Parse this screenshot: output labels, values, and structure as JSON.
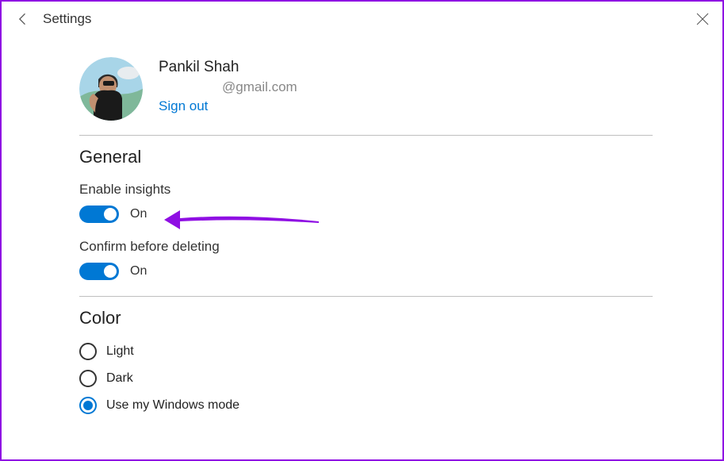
{
  "window": {
    "title": "Settings"
  },
  "profile": {
    "name": "Pankil Shah",
    "email": "@gmail.com",
    "signout": "Sign out"
  },
  "sections": {
    "general": {
      "heading": "General",
      "enable_insights": {
        "label": "Enable insights",
        "state": "On",
        "value": true
      },
      "confirm_delete": {
        "label": "Confirm before deleting",
        "state": "On",
        "value": true
      }
    },
    "color": {
      "heading": "Color",
      "options": [
        {
          "label": "Light",
          "selected": false
        },
        {
          "label": "Dark",
          "selected": false
        },
        {
          "label": "Use my Windows mode",
          "selected": true
        }
      ]
    }
  },
  "colors": {
    "accent": "#0078d4",
    "annotation": "#8f0fe3"
  }
}
